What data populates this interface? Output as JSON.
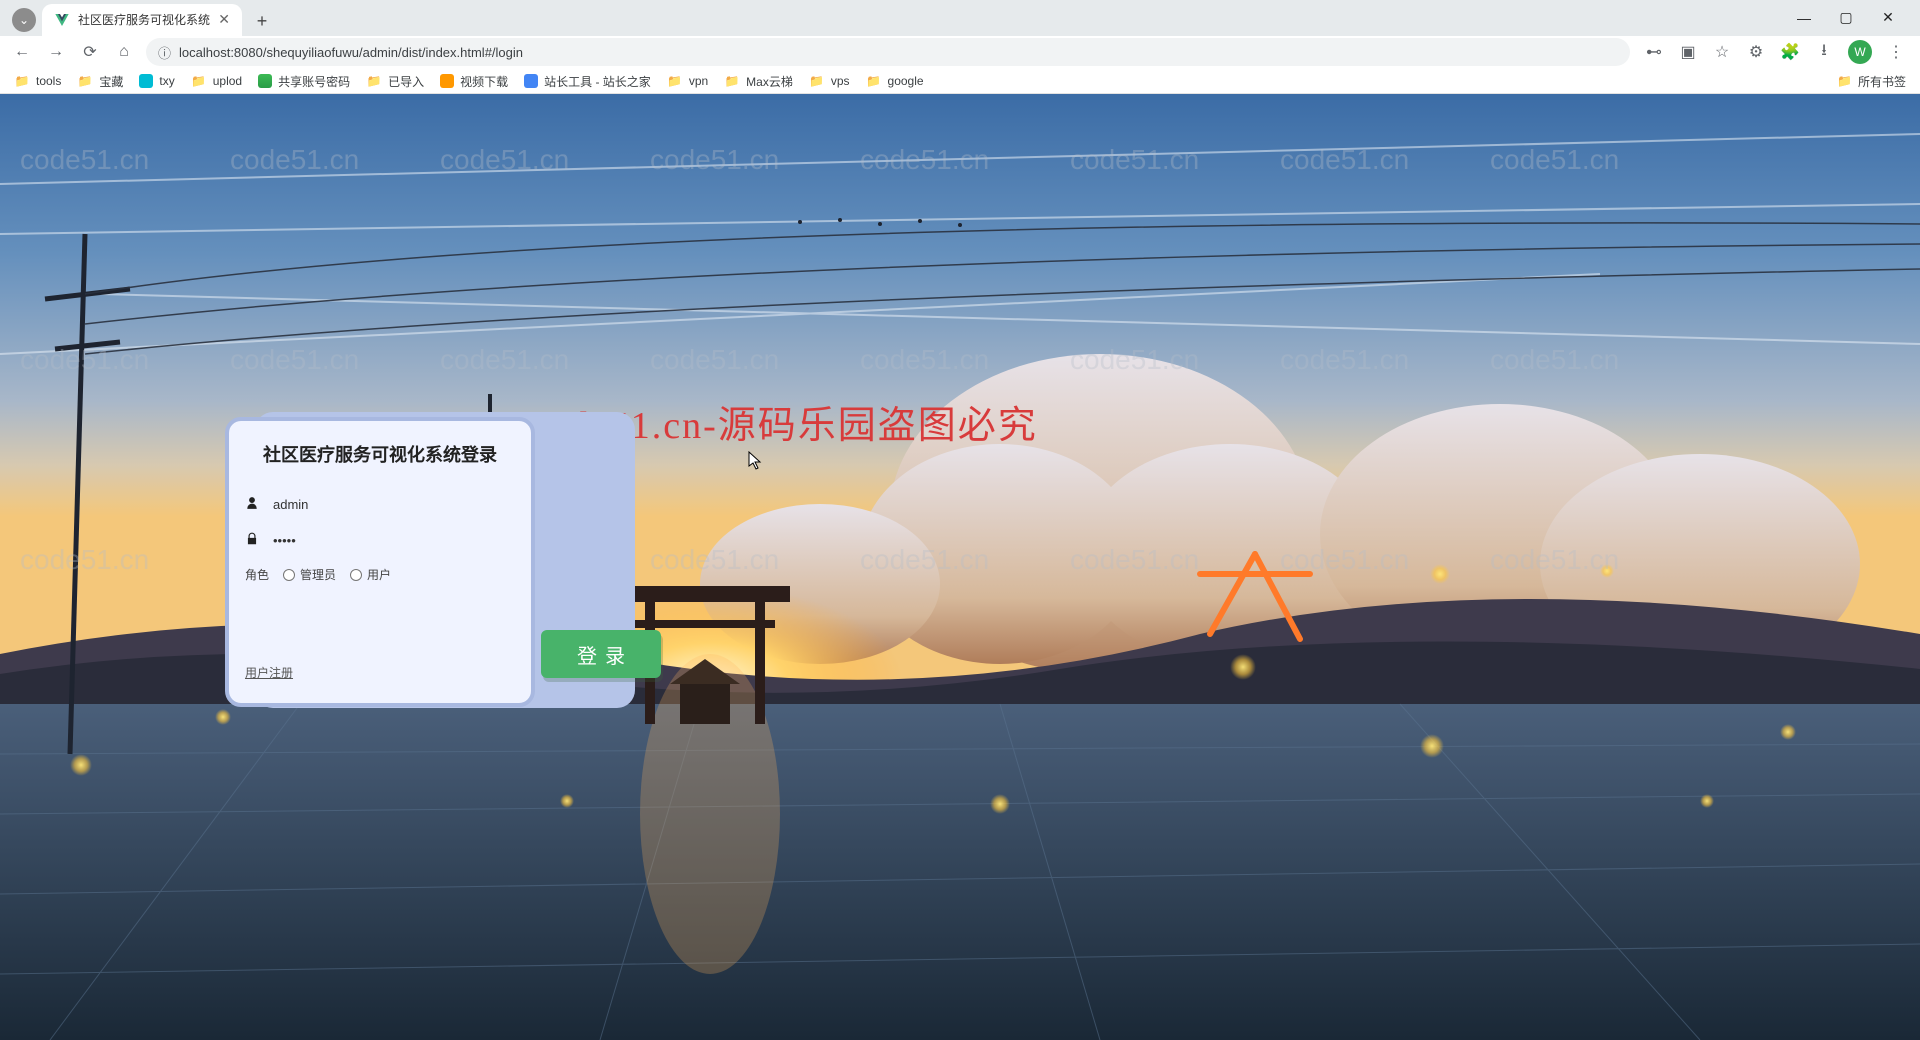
{
  "browser": {
    "tab_title": "社区医疗服务可视化系统",
    "url": "localhost:8080/shequyiliaofuwu/admin/dist/index.html#/login",
    "avatar_initial": "W",
    "bookmarks": [
      {
        "label": "tools",
        "icon": "folder"
      },
      {
        "label": "宝藏",
        "icon": "folder"
      },
      {
        "label": "txy",
        "icon": "teal"
      },
      {
        "label": "uplod",
        "icon": "folder"
      },
      {
        "label": "共享账号密码",
        "icon": "green"
      },
      {
        "label": "已导入",
        "icon": "folder"
      },
      {
        "label": "视频下载",
        "icon": "orange"
      },
      {
        "label": "站长工具 - 站长之家",
        "icon": "blue"
      },
      {
        "label": "vpn",
        "icon": "folder"
      },
      {
        "label": "Max云梯",
        "icon": "folder"
      },
      {
        "label": "vps",
        "icon": "folder"
      },
      {
        "label": "google",
        "icon": "folder"
      }
    ],
    "all_bookmarks_label": "所有书签"
  },
  "login": {
    "title": "社区医疗服务可视化系统登录",
    "username_value": "admin",
    "password_value": "•••••",
    "role_label": "角色",
    "role_admin": "管理员",
    "role_user": "用户",
    "login_button": "登录",
    "register_link": "用户注册"
  },
  "watermark": {
    "text": "code51.cn",
    "banner": "code51.cn-源码乐园盗图必究"
  }
}
